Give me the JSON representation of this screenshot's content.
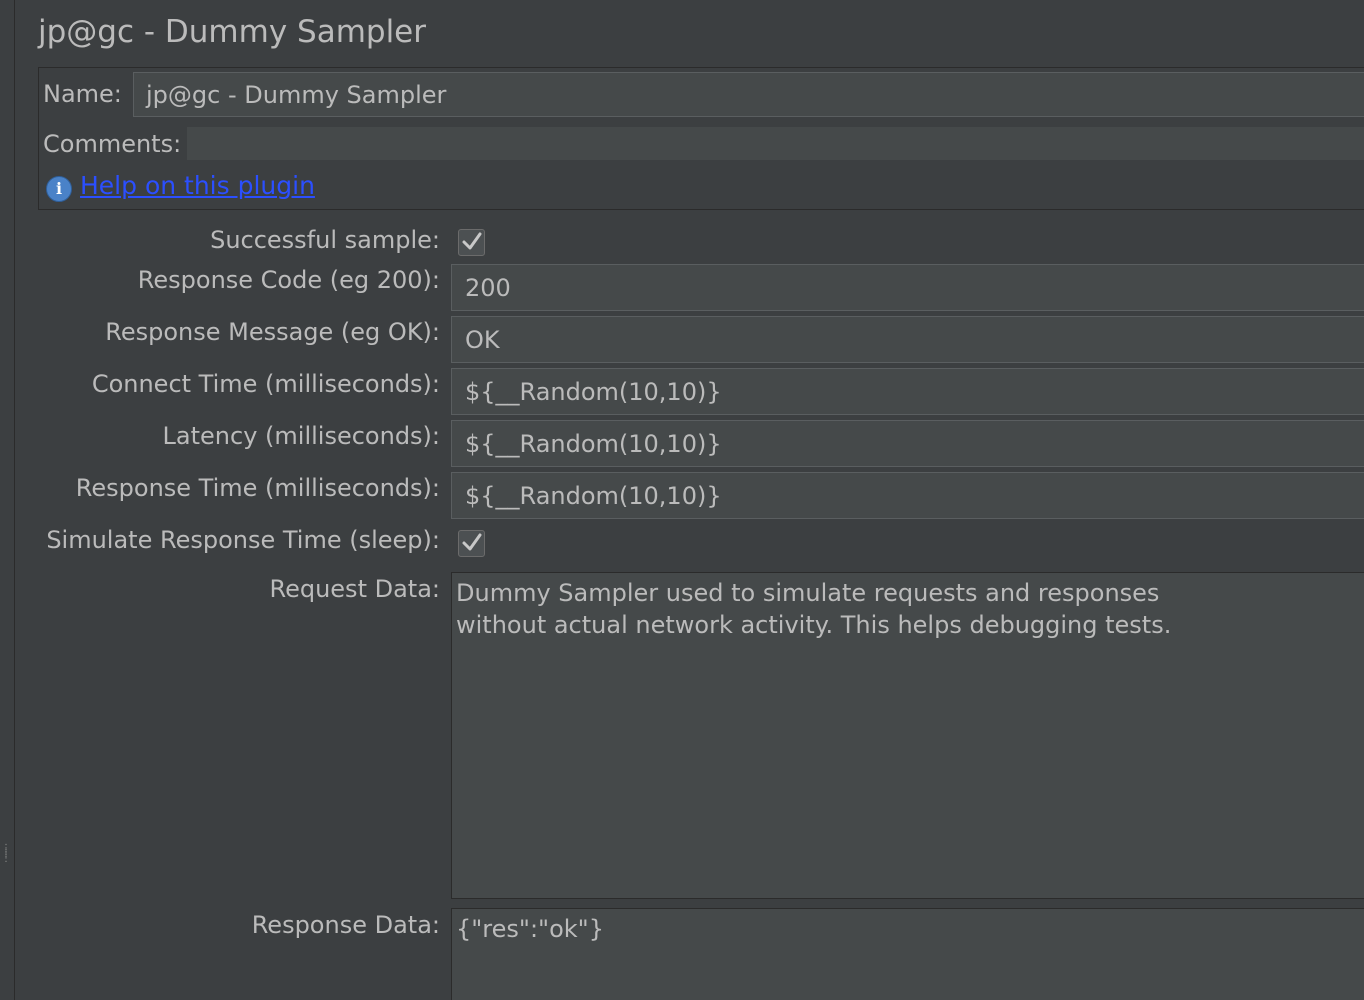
{
  "window": {
    "title": "jp@gc - Dummy Sampler"
  },
  "header": {
    "name_label": "Name:",
    "name_value": "jp@gc - Dummy Sampler",
    "comments_label": "Comments:",
    "comments_value": "",
    "help_link": "Help on this plugin",
    "help_icon": "info-icon"
  },
  "form": {
    "successful_sample_label": "Successful sample:",
    "successful_sample_checked": true,
    "response_code_label": "Response Code (eg 200):",
    "response_code_value": "200",
    "response_message_label": "Response Message (eg OK):",
    "response_message_value": "OK",
    "connect_time_label": "Connect Time (milliseconds):",
    "connect_time_value": "${__Random(10,10)}",
    "latency_label": "Latency (milliseconds):",
    "latency_value": "${__Random(10,10)}",
    "response_time_label": "Response Time (milliseconds):",
    "response_time_value": "${__Random(10,10)}",
    "simulate_label": "Simulate Response Time (sleep):",
    "simulate_checked": true,
    "request_data_label": "Request Data:",
    "request_data_value": "Dummy Sampler used to simulate requests and responses\nwithout actual network activity. This helps debugging tests.",
    "response_data_label": "Response Data:",
    "response_data_value": "{\"res\":\"ok\"}"
  },
  "colors": {
    "background": "#3c3f41",
    "field_background": "#45494a",
    "text": "#bbbbbb",
    "link": "#2b4fff",
    "info_icon": "#4a82c8"
  }
}
